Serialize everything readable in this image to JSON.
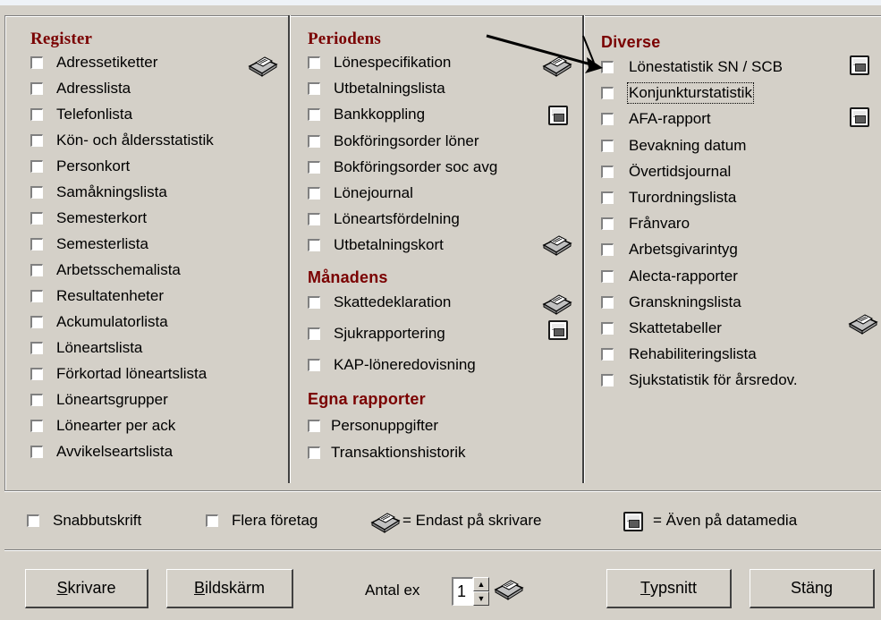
{
  "register": {
    "title": "Register",
    "items": [
      "Adressetiketter",
      "Adresslista",
      "Telefonlista",
      "Kön- och åldersstatistik",
      "Personkort",
      "Samåkningslista",
      "Semesterkort",
      "Semesterlista",
      "Arbetsschemalista",
      "Resultatenheter",
      "Ackumulatorlista",
      "Löneartslista",
      "Förkortad löneartslista",
      "Löneartsgrupper",
      "Lönearter per ack",
      "Avvikelseartslista"
    ]
  },
  "periodens": {
    "title": "Periodens",
    "items": [
      "Lönespecifikation",
      "Utbetalningslista",
      "Bankkoppling",
      "Bokföringsorder löner",
      "Bokföringsorder soc avg",
      "Lönejournal",
      "Löneartsfördelning",
      "Utbetalningskort"
    ]
  },
  "manadens": {
    "title": "Månadens",
    "items": [
      "Skattedeklaration",
      "Sjukrapportering",
      "KAP-löneredovisning"
    ]
  },
  "egna": {
    "title": "Egna rapporter",
    "items": [
      "Personuppgifter",
      "Transaktionshistorik"
    ]
  },
  "diverse": {
    "title": "Diverse",
    "items": [
      "Lönestatistik SN / SCB",
      "Konjunkturstatistik",
      "AFA-rapport",
      "Bevakning datum",
      "Övertidsjournal",
      "Turordningslista",
      "Frånvaro",
      "Arbetsgivarintyg",
      "Alecta-rapporter",
      "Granskningslista",
      "Skattetabeller",
      "Rehabiliteringslista",
      "Sjukstatistik för årsredov."
    ]
  },
  "options": {
    "snabb": "Snabbutskrift",
    "flera": "Flera företag",
    "printer_legend": "= Endast på skrivare",
    "disk_legend": "= Även på datamedia"
  },
  "buttons": {
    "skrivare_u": "S",
    "skrivare_rest": "krivare",
    "bildskarm_u": "B",
    "bildskarm_rest": "ildskärm",
    "typsnitt_u": "T",
    "typsnitt_rest": "ypsnitt",
    "stang": "Stäng"
  },
  "copies": {
    "label": "Antal ex",
    "value": "1"
  },
  "icons": {
    "printer": "printer-icon",
    "disk": "floppy-disk-icon",
    "arrow": "annotation-arrow"
  }
}
